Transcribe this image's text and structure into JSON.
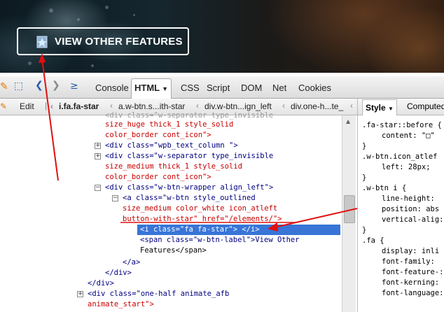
{
  "hero": {
    "cta_label": "VIEW OTHER FEATURES"
  },
  "toolbar": {
    "tabs": [
      "Console",
      "HTML",
      "CSS",
      "Script",
      "DOM",
      "Net",
      "Cookies"
    ],
    "active_tab": "HTML"
  },
  "breadcrumb": {
    "edit_label": "Edit",
    "items": [
      "i.fa.fa-star",
      "a.w-btn.s...ith-star",
      "div.w-btn...ign_left",
      "div.one-h...te_"
    ]
  },
  "style_panel": {
    "tabs": [
      "Style",
      "Computed"
    ],
    "active_tab": "Style",
    "rules": [
      {
        "selector": ".fa-star::before {",
        "props": [
          [
            "content",
            "\"□\""
          ]
        ]
      },
      {
        "selector": ".w-btn.icon_atlef",
        "props": [
          [
            "left",
            "28px;"
          ]
        ]
      },
      {
        "selector": ".w-btn i {",
        "props": [
          [
            "line-height",
            ""
          ],
          [
            "position",
            "abs"
          ],
          [
            "vertical-alig",
            ""
          ]
        ]
      },
      {
        "selector": ".fa {",
        "props": [
          [
            "display",
            "inli"
          ],
          [
            "font-family",
            ""
          ],
          [
            "font-feature-",
            ""
          ],
          [
            "font-kerning",
            ""
          ],
          [
            "font-language",
            ""
          ]
        ]
      }
    ]
  },
  "html_lines": {
    "l0": "<div class=\"w-separator type_invisible",
    "l1a": "size_huge thick_1 style_solid",
    "l1b": "color_border cont_icon\">",
    "l2": "<div class=\"wpb_text_column \">",
    "l3a": "<div class=\"w-separator type_invisible",
    "l3b": "size_medium thick_1 style_solid",
    "l3c": "color_border cont_icon\">",
    "l4": "<div class=\"w-btn-wrapper align_left\">",
    "l5a": "<a class=\"w-btn style_outlined",
    "l5b": "size_medium color_white icon_atleft",
    "l5c": "button-with-star\" href=\"/elements/\">",
    "l6": "<i class=\"fa fa-star\"> </i>",
    "l7a": "<span class=\"w-btn-label\">View Other",
    "l7b": "Features</span>",
    "l8": "</a>",
    "l9": "</div>",
    "l10": "</div>",
    "l11a": "<div class=\"one-half animate_afb",
    "l11b": "animate_start\">"
  }
}
